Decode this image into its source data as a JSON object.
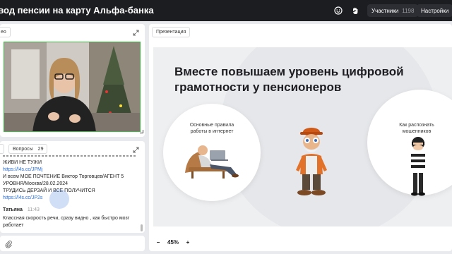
{
  "header": {
    "title": "евод пенсии на карту Альфа-банка",
    "participants_label": "Участники",
    "participants_count": "1198",
    "settings_label": "Настройки"
  },
  "video_panel": {
    "tag_label": "ео"
  },
  "chat_panel": {
    "questions_tab": "Вопросы",
    "questions_count": "29",
    "lines": [
      {
        "text": "ЖИВИ НЕ ТУЖИ",
        "type": "text"
      },
      {
        "text": "https://l4s.cc/JPMj",
        "type": "link"
      },
      {
        "text": "И всем МОЕ ПОЧТЕНИЕ Виктор Торговцев/АГЕНТ 5",
        "type": "text"
      },
      {
        "text": "УРОВНЯ/Москва/28.02.2024",
        "type": "text"
      },
      {
        "text": "ТРУДИСЬ ДЕРЗАЙ И ВСЕ ПОЛУЧИТСЯ",
        "type": "text"
      },
      {
        "text": "https://l4s.cc/JP2s",
        "type": "link"
      }
    ],
    "message": {
      "author": "Татьяна",
      "time": "11:43",
      "text_line1": "Классная скорость речи, сразу видно , как быстро мозг",
      "text_line2": "работает"
    }
  },
  "presentation": {
    "tag_label": "Презентация",
    "slide_title_line1": "Вместе повышаем уровень цифровой",
    "slide_title_line2": "грамотности у пенсионеров",
    "left_circle_label_line1": "Основные правила",
    "left_circle_label_line2": "работы в интернет",
    "right_circle_label_line1": "Как распознать",
    "right_circle_label_line2": "мошенников",
    "zoom": "45%",
    "zoom_out": "−",
    "zoom_in": "+"
  }
}
